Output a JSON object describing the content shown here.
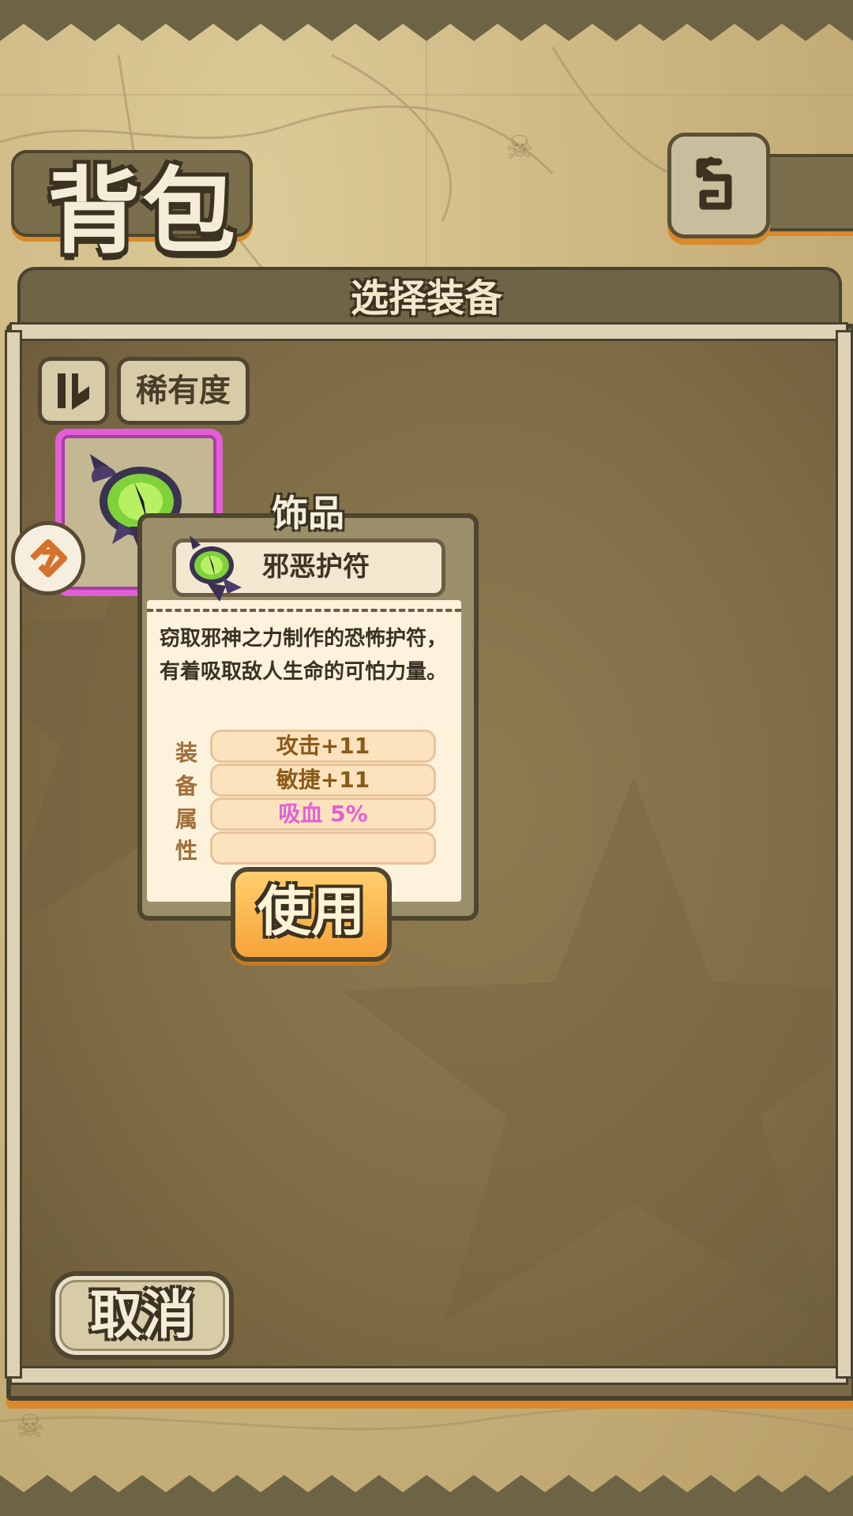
{
  "header": {
    "title": "背包"
  },
  "panel": {
    "title": "选择装备"
  },
  "filters": {
    "rarity_label": "稀有度"
  },
  "inventory": {
    "items": [
      {
        "name": "邪恶护符",
        "rarity_color": "#e25ed9",
        "equipped": true,
        "icon": "evil-eye-amulet-icon"
      }
    ]
  },
  "tooltip": {
    "category": "饰品",
    "item_name": "邪恶护符",
    "description": "窃取邪神之力制作的恐怖护符，有着吸取敌人生命的可怕力量。",
    "attr_labels": [
      "装",
      "备",
      "属",
      "性"
    ],
    "stats": [
      "攻击+11",
      "敏捷+11",
      "吸血 5%",
      ""
    ],
    "stat_colors": [
      "#8a5a1a",
      "#8a5a1a",
      "#e35fd8",
      "#8a5a1a"
    ],
    "use_label": "使用"
  },
  "footer": {
    "cancel_label": "取消"
  },
  "colors": {
    "accent_orange": "#d98a2a",
    "frame_brown": "#4a4230",
    "rarity_epic": "#e25ed9",
    "lifesteal_pink": "#e35fd8"
  }
}
